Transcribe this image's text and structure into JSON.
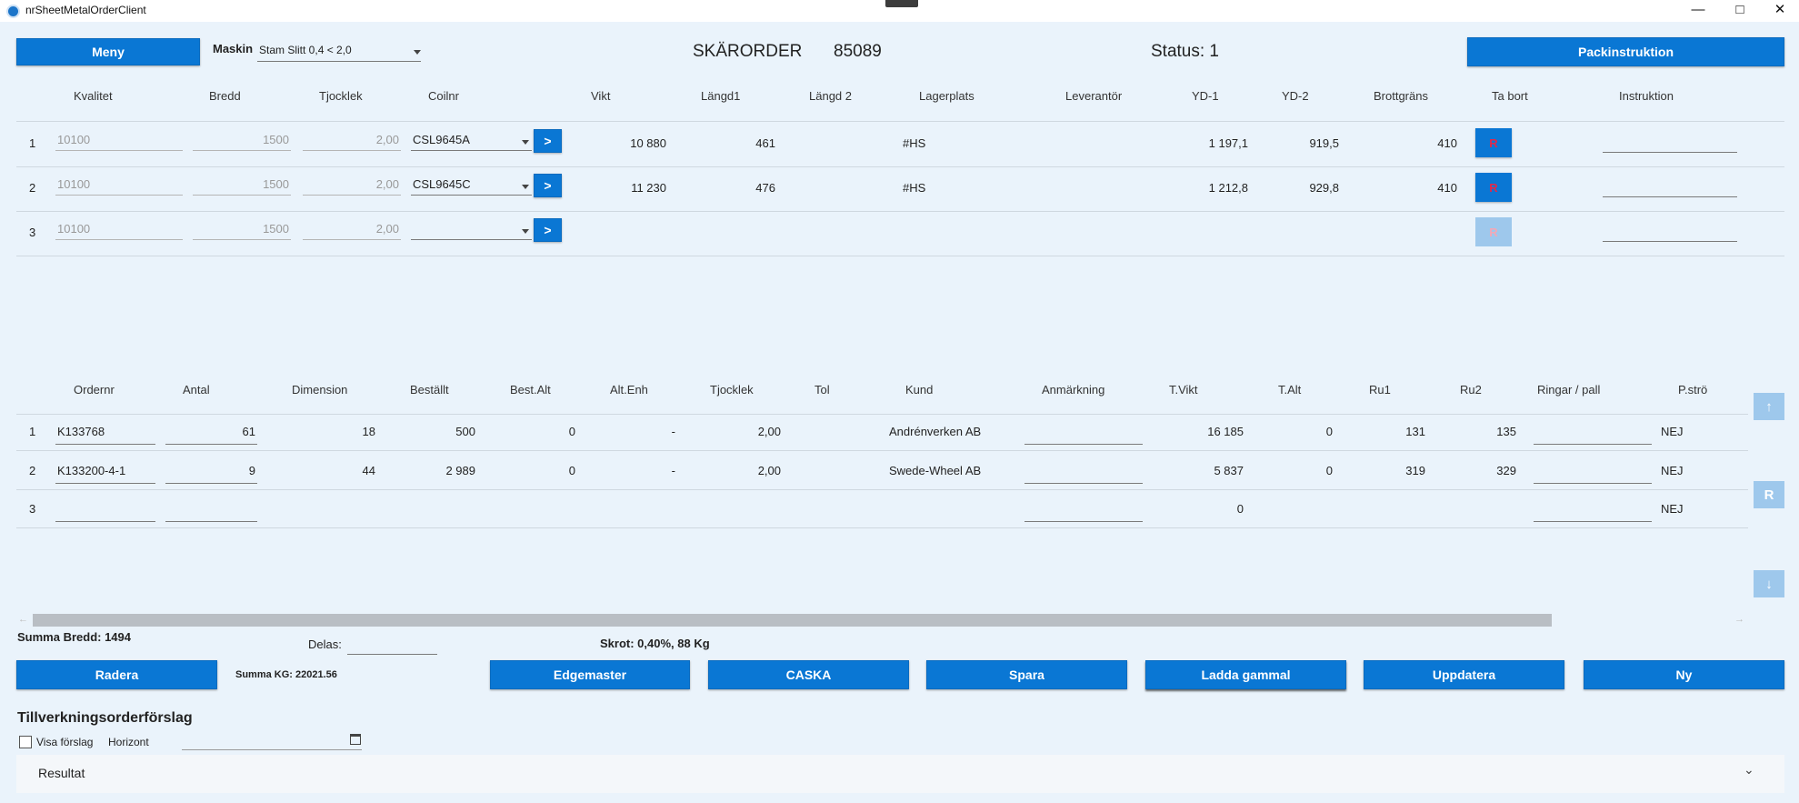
{
  "window": {
    "title": "nrSheetMetalOrderClient",
    "min_icon": "minimize-icon",
    "max_icon": "maximize-icon",
    "close_icon": "close-icon"
  },
  "header": {
    "menu_label": "Meny",
    "machine_label": "Maskin",
    "machine_value": "Stam Slitt 0,4 < 2,0",
    "order_title": "SKÄRORDER",
    "order_number": "85089",
    "status": "Status: 1",
    "pack_button": "Packinstruktion"
  },
  "coil_table": {
    "headers": [
      "Kvalitet",
      "Bredd",
      "Tjocklek",
      "Coilnr",
      "Vikt",
      "Längd1",
      "Längd 2",
      "Lagerplats",
      "Leverantör",
      "YD-1",
      "YD-2",
      "Brottgräns",
      "Ta bort",
      "Instruktion"
    ],
    "go_label": ">",
    "remove_label": "R",
    "rows": [
      {
        "num": "1",
        "kvalitet": "10100",
        "bredd": "1500",
        "tjocklek": "2,00",
        "coilnr": "CSL9645A",
        "vikt": "10 880",
        "langd1": "461",
        "langd2": "",
        "lagerplats": "#HS",
        "leverantor": "",
        "yd1": "1 197,1",
        "yd2": "919,5",
        "brottgrans": "410",
        "instruktion": ""
      },
      {
        "num": "2",
        "kvalitet": "10100",
        "bredd": "1500",
        "tjocklek": "2,00",
        "coilnr": "CSL9645C",
        "vikt": "11 230",
        "langd1": "476",
        "langd2": "",
        "lagerplats": "#HS",
        "leverantor": "",
        "yd1": "1 212,8",
        "yd2": "929,8",
        "brottgrans": "410",
        "instruktion": ""
      },
      {
        "num": "3",
        "kvalitet": "10100",
        "bredd": "1500",
        "tjocklek": "2,00",
        "coilnr": "",
        "vikt": "",
        "langd1": "",
        "langd2": "",
        "lagerplats": "",
        "leverantor": "",
        "yd1": "",
        "yd2": "",
        "brottgrans": "",
        "instruktion": ""
      }
    ]
  },
  "order_table": {
    "headers": [
      "Ordernr",
      "Antal",
      "Dimension",
      "Beställt",
      "Best.Alt",
      "Alt.Enh",
      "Tjocklek",
      "Tol",
      "Kund",
      "Anmärkning",
      "T.Vikt",
      "T.Alt",
      "Ru1",
      "Ru2",
      "Ringar / pall",
      "P.strö"
    ],
    "rows": [
      {
        "num": "1",
        "ordernr": "K133768",
        "antal": "61",
        "dimension": "18",
        "bestallt": "500",
        "bestalt": "0",
        "altenh": "-",
        "tjocklek": "2,00",
        "tol": "",
        "kund": "Andrénverken AB",
        "anmarkning": "",
        "tvikt": "16 185",
        "talt": "0",
        "ru1": "131",
        "ru2": "135",
        "ringar": "",
        "pstro": "NEJ"
      },
      {
        "num": "2",
        "ordernr": "K133200-4-1",
        "antal": "9",
        "dimension": "44",
        "bestallt": "2 989",
        "bestalt": "0",
        "altenh": "-",
        "tjocklek": "2,00",
        "tol": "",
        "kund": "Swede-Wheel AB",
        "anmarkning": "",
        "tvikt": "5 837",
        "talt": "0",
        "ru1": "319",
        "ru2": "329",
        "ringar": "",
        "pstro": "NEJ"
      },
      {
        "num": "3",
        "ordernr": "",
        "antal": "",
        "dimension": "",
        "bestallt": "",
        "bestalt": "",
        "altenh": "",
        "tjocklek": "",
        "tol": "",
        "kund": "",
        "anmarkning": "",
        "tvikt": "0",
        "talt": "",
        "ru1": "",
        "ru2": "",
        "ringar": "",
        "pstro": "NEJ"
      }
    ],
    "side_up": "↑",
    "side_r": "R",
    "side_down": "↓"
  },
  "summary": {
    "summa_bredd": "Summa Bredd: 1494",
    "delas_label": "Delas:",
    "skrot": "Skrot: 0,40%, 88 Kg",
    "summa_kg": "Summa KG: 22021.56"
  },
  "actions": {
    "radera": "Radera",
    "edgemaster": "Edgemaster",
    "caska": "CASKA",
    "spara": "Spara",
    "ladda": "Ladda gammal",
    "uppdatera": "Uppdatera",
    "ny": "Ny"
  },
  "suggestion": {
    "title": "Tillverkningsorderförslag",
    "visa_label": "Visa förslag",
    "horizont_label": "Horizont",
    "result_label": "Resultat"
  },
  "colors": {
    "accent": "#0a77d4",
    "background": "#eaf3fb",
    "remove_text": "#e0294a"
  }
}
